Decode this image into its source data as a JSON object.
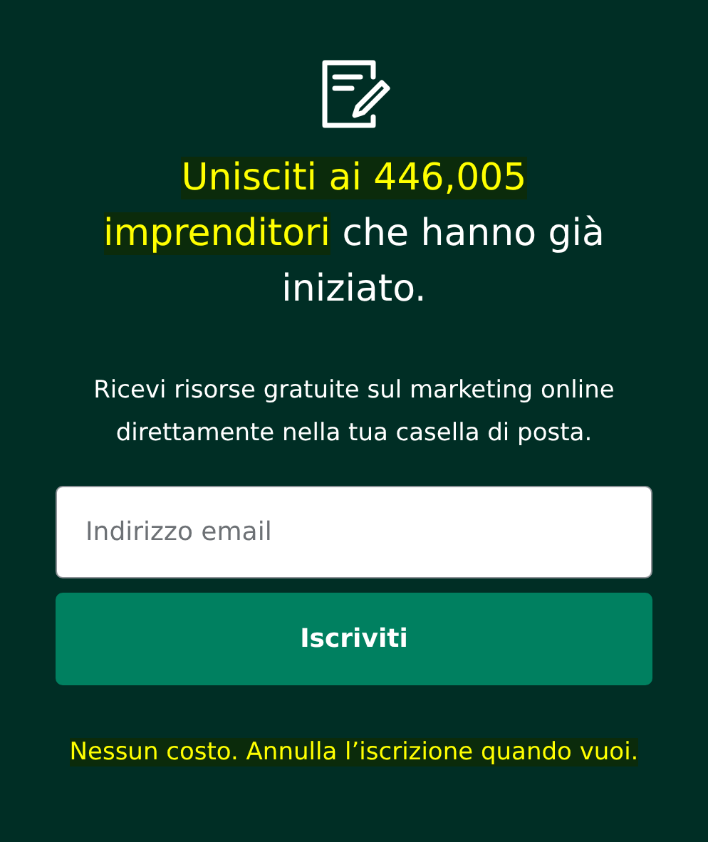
{
  "heading": {
    "highlighted": "Unisciti ai 446,005 imprenditori",
    "rest": " che hanno già iniziato."
  },
  "description": "Ricevi risorse gratuite sul marketing online direttamente nella tua casella di posta.",
  "email_field": {
    "placeholder": "Indirizzo email"
  },
  "submit_button": "Iscriviti",
  "note": {
    "text": "Nessun costo. Annulla l’iscrizione quando vuoi.",
    "highlighted": true
  }
}
